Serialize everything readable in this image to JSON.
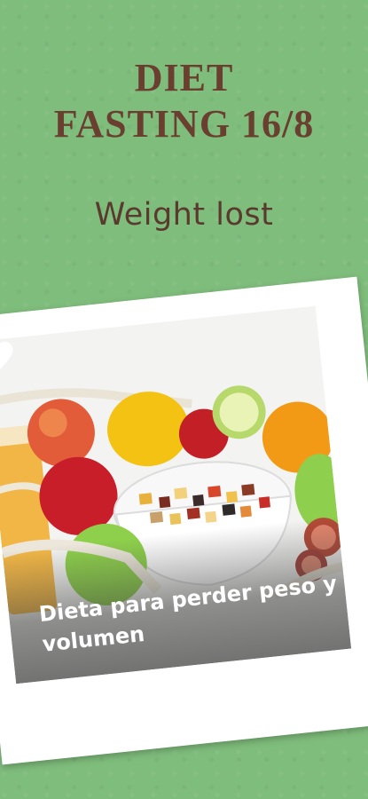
{
  "header": {
    "title_line1": "DIET",
    "title_line2": "FASTING 16/8",
    "subtitle": "Weight lost"
  },
  "card": {
    "caption": "Dieta para perder peso y volumen",
    "favorite_icon": "heart-icon"
  },
  "colors": {
    "background": "#7fbd7c",
    "title": "#6a3f2f",
    "card": "#ffffff"
  }
}
